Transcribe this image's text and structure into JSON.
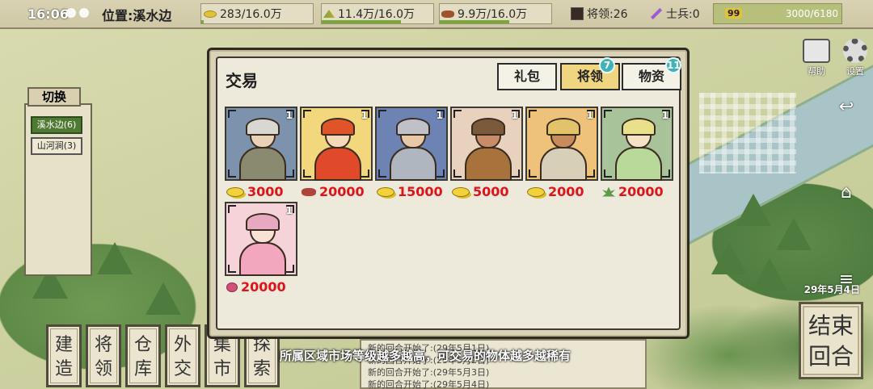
{
  "status_bar": {
    "time": "16:06",
    "location": "位置:溪水边",
    "gold": "283/16.0万",
    "grain": "11.4万/16.0万",
    "meat": "9.9万/16.0万",
    "generals": "将领:26",
    "soldiers": "士兵:0",
    "level_badge": "99",
    "progress_text": "3000/6180"
  },
  "right_controls": {
    "help_label": "帮助",
    "settings_label": "设置",
    "map_date": "29年5月4日",
    "end_turn": [
      "结束",
      "回合"
    ]
  },
  "switch_panel": {
    "title": "切换",
    "items": [
      {
        "label": "溪水边(6)",
        "active": true
      },
      {
        "label": "山河涧(3)",
        "active": false
      }
    ]
  },
  "actions": [
    {
      "label": [
        "建",
        "造"
      ]
    },
    {
      "label": [
        "将",
        "领"
      ]
    },
    {
      "label": [
        "仓",
        "库"
      ]
    },
    {
      "label": [
        "外",
        "交"
      ]
    },
    {
      "label": [
        "集",
        "市"
      ]
    },
    {
      "label": [
        "探",
        "索"
      ]
    }
  ],
  "log": {
    "lines": [
      "新的回合开始了:(29年5月1日)",
      "新的回合开始了:(29年5月2日)",
      "新的回合开始了:(29年5月3日)",
      "新的回合开始了:(29年5月4日)"
    ]
  },
  "tip": "所属区域市场等级越多越高，可交易的物体越多越稀有",
  "dialog": {
    "title": "交易",
    "tabs": [
      {
        "label": "礼包",
        "active": false,
        "badge": ""
      },
      {
        "label": "将领",
        "active": true,
        "badge": "7"
      },
      {
        "label": "物资",
        "active": false,
        "badge": "11"
      }
    ],
    "cards": [
      {
        "count": "1",
        "price": "3000",
        "currency": "gold",
        "bg": "#7d93ad",
        "subject": "elder-sage"
      },
      {
        "count": "1",
        "price": "20000",
        "currency": "meat",
        "bg": "#f2d77c",
        "subject": "fire-fairy"
      },
      {
        "count": "1",
        "price": "15000",
        "currency": "gold",
        "bg": "#6d83b3",
        "subject": "knight"
      },
      {
        "count": "1",
        "price": "5000",
        "currency": "gold",
        "bg": "#e8d2bd",
        "subject": "warrior"
      },
      {
        "count": "1",
        "price": "2000",
        "currency": "gold",
        "bg": "#eec27a",
        "subject": "farmer"
      },
      {
        "count": "1",
        "price": "20000",
        "currency": "herb",
        "bg": "#a8c29a",
        "subject": "forest-elf"
      },
      {
        "count": "1",
        "price": "20000",
        "currency": "rose",
        "bg": "#f5d3d8",
        "subject": "flower-fairy"
      }
    ]
  }
}
